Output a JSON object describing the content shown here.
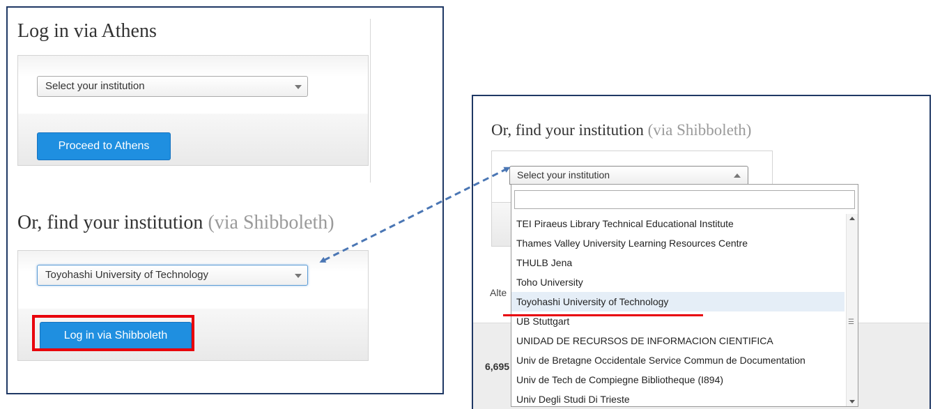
{
  "athens": {
    "title": "Log in via Athens",
    "select_value": "Select your institution",
    "button_label": "Proceed to Athens"
  },
  "shibboleth": {
    "title_main": "Or, find your institution",
    "title_suffix": "(via Shibboleth)",
    "select_value": "Toyohashi University of Technology",
    "button_label": "Log in via Shibboleth"
  },
  "zoom": {
    "title_main": "Or, find your institution",
    "title_suffix": "(via Shibboleth)",
    "select_value": "Select your institution",
    "alt_text": "Alte",
    "count_text": "6,695",
    "search_value": "",
    "options": [
      "TEI Piraeus Library Technical Educational Institute",
      "Thames Valley University Learning Resources Centre",
      "THULB Jena",
      "Toho University",
      "Toyohashi University of Technology",
      "UB Stuttgart",
      "UNIDAD DE RECURSOS DE INFORMACION CIENTIFICA",
      "Univ de Bretagne Occidentale Service Commun de Documentation",
      "Univ de Tech de Compiegne Bibliotheque (I894)",
      "Univ Degli Studi Di Trieste"
    ],
    "highlighted_option": "Toyohashi University of Technology"
  },
  "colors": {
    "frame": "#1f3864",
    "button": "#1f8fe0",
    "highlight_red": "#e8000b",
    "arrow": "#4a76b4"
  }
}
